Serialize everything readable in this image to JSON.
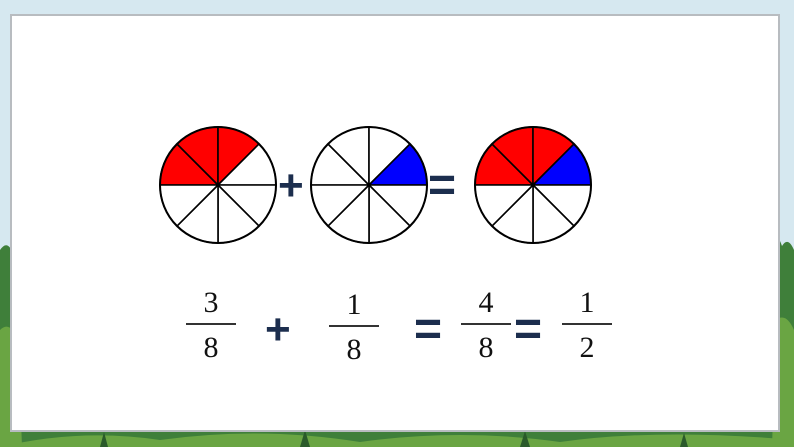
{
  "colors": {
    "red": "#ff0000",
    "blue": "#0000ff",
    "white": "#ffffff",
    "outline": "#000000",
    "operator": "#1c2e4e"
  },
  "pies": [
    {
      "slices": 8,
      "shaded_red": 3,
      "shaded_blue": 0
    },
    {
      "slices": 8,
      "shaded_red": 0,
      "shaded_blue": 1
    },
    {
      "slices": 8,
      "shaded_red": 3,
      "shaded_blue": 1
    }
  ],
  "pie_operators": {
    "plus": "+",
    "equals": "="
  },
  "equation": {
    "term1": {
      "numerator": "3",
      "denominator": "8"
    },
    "plus": "+",
    "term2": {
      "numerator": "1",
      "denominator": "8"
    },
    "equals1": "=",
    "term3": {
      "numerator": "4",
      "denominator": "8"
    },
    "equals2": "=",
    "term4": {
      "numerator": "1",
      "denominator": "2"
    }
  }
}
